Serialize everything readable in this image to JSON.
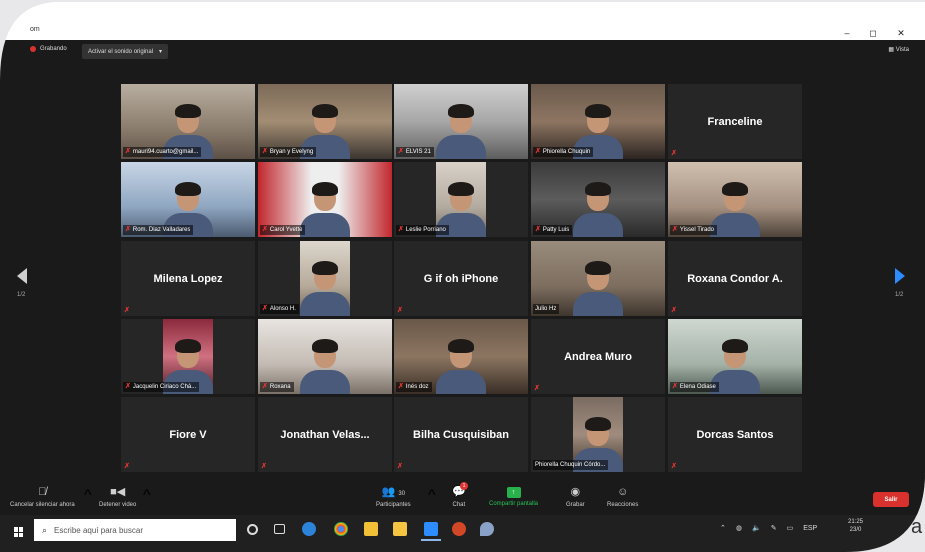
{
  "window": {
    "title": "om",
    "minimize": "–",
    "maximize": "◻",
    "close": "✕"
  },
  "topbar": {
    "recording_label": "Grabando",
    "audio_button": "Activar el sonido original",
    "audio_caret": "▾",
    "view_button": "Vista"
  },
  "pager": {
    "left": "1/2",
    "right": "1/2"
  },
  "tiles": [
    {
      "name": "mauri94.cuarto@gmail...",
      "video": "a",
      "muted": true
    },
    {
      "name": "Bryan y Evelyng",
      "video": "b",
      "muted": true
    },
    {
      "name": "ELVIS 21",
      "video": "c",
      "muted": true
    },
    {
      "name": "Phiorella Chuquin",
      "video": "d",
      "muted": true
    },
    {
      "big": "Franceline",
      "muted": true
    },
    {
      "name": "Rom. Diaz Valladares",
      "video": "f",
      "muted": true,
      "active": true
    },
    {
      "name": "Carol Yvette",
      "video": "g",
      "muted": true
    },
    {
      "name": "Leslie Porriano",
      "video": "e",
      "partial": true,
      "muted": true
    },
    {
      "name": "Patty Luis",
      "video": "i",
      "muted": true
    },
    {
      "name": "Yissel Tirado",
      "video": "j",
      "muted": true
    },
    {
      "big": "Milena Lopez",
      "muted": true
    },
    {
      "name": "Alonso H.",
      "video": "k",
      "partial": true,
      "muted": true
    },
    {
      "big": "G if oh iPhone",
      "muted": true
    },
    {
      "name": "Julio Hz",
      "video": "l",
      "muted": false
    },
    {
      "big": "Roxana Condor A.",
      "muted": true
    },
    {
      "name": "Jacquelin Ciriaco Chá...",
      "video": "m",
      "partial": true,
      "muted": true
    },
    {
      "name": "Roxana",
      "video": "n",
      "muted": true
    },
    {
      "name": "Inés doz",
      "video": "o",
      "muted": true
    },
    {
      "big": "Andrea Muro",
      "muted": true
    },
    {
      "name": "Elena Odiase",
      "video": "p",
      "muted": true
    },
    {
      "big": "Fiore V",
      "muted": true
    },
    {
      "big": "Jonathan  Velas...",
      "muted": true
    },
    {
      "big": "Bilha Cusquisiban",
      "muted": true
    },
    {
      "name": "Phiorella Chuquin Córdo...",
      "video": "q",
      "partial": true,
      "muted": false
    },
    {
      "big": "Dorcas Santos",
      "muted": true
    }
  ],
  "controls": {
    "unmute": "Cancelar silenciar ahora",
    "stop_video": "Detener video",
    "participants": "Participantes",
    "participants_count": "30",
    "chat": "Chat",
    "chat_badge": "1",
    "share": "Compartir pantalla",
    "record": "Grabar",
    "reactions": "Reacciones",
    "leave": "Salir",
    "caret": "^"
  },
  "taskbar": {
    "search_placeholder": "Escribe aquí para buscar",
    "tray_lang": "ESP",
    "time": "21:25",
    "date": "23/0"
  },
  "stray_text": "a",
  "colors": {
    "accent_blue": "#2d8cff",
    "share_green": "#28b24b",
    "leave_red": "#d9322e",
    "muted_red": "#e03434",
    "active_outline": "#b8d53a"
  }
}
